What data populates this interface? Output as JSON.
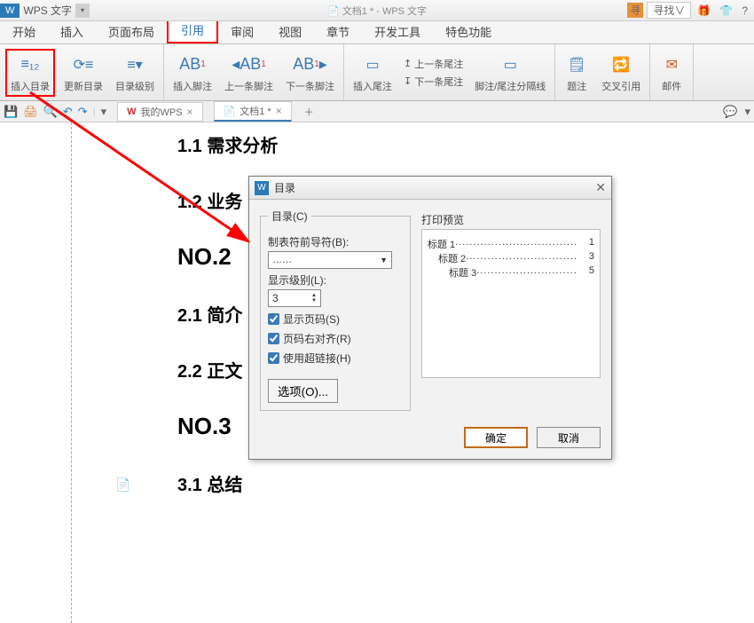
{
  "titlebar": {
    "app_logo": "W",
    "app_name": "WPS 文字",
    "doc_title": "文档1 * - WPS 文字",
    "search_label": "寻找∨",
    "orange_badge": "寻"
  },
  "tabs": {
    "items": [
      "开始",
      "插入",
      "页面布局",
      "引用",
      "审阅",
      "视图",
      "章节",
      "开发工具",
      "特色功能"
    ],
    "active_index": 3
  },
  "ribbon": {
    "insert_toc": "插入目录",
    "update_toc": "更新目录",
    "toc_level": "目录级别",
    "insert_footnote": "插入脚注",
    "prev_footnote": "上一条脚注",
    "next_footnote": "下一条脚注",
    "insert_endnote": "插入尾注",
    "prev_endnote": "上一条尾注",
    "next_endnote": "下一条尾注",
    "fn_en_separator": "脚注/尾注分隔线",
    "caption": "题注",
    "cross_ref": "交叉引用",
    "mail": "邮件",
    "ab": "AB"
  },
  "quickbar": {
    "tab1": "我的WPS",
    "tab2": "文档1 *"
  },
  "document": {
    "h11": "1.1 需求分析",
    "h12": "1.2 业务",
    "no2": "NO.2",
    "h21": "2.1 简介",
    "h22": "2.2 正文",
    "no3": "NO.3",
    "h31": "3.1 总结"
  },
  "dialog": {
    "title": "目录",
    "group_label": "目录(C)",
    "leader_label": "制表符前导符(B):",
    "leader_value": "……",
    "level_label": "显示级别(L):",
    "level_value": "3",
    "chk_page": "显示页码(S)",
    "chk_align": "页码右对齐(R)",
    "chk_hyperlink": "使用超链接(H)",
    "options_btn": "选项(O)...",
    "preview_label": "打印预览",
    "preview": {
      "lines": [
        {
          "title": "标题 1",
          "page": "1",
          "indent": 0
        },
        {
          "title": "标题 2",
          "page": "3",
          "indent": 1
        },
        {
          "title": "标题 3",
          "page": "5",
          "indent": 2
        }
      ]
    },
    "ok": "确定",
    "cancel": "取消"
  }
}
